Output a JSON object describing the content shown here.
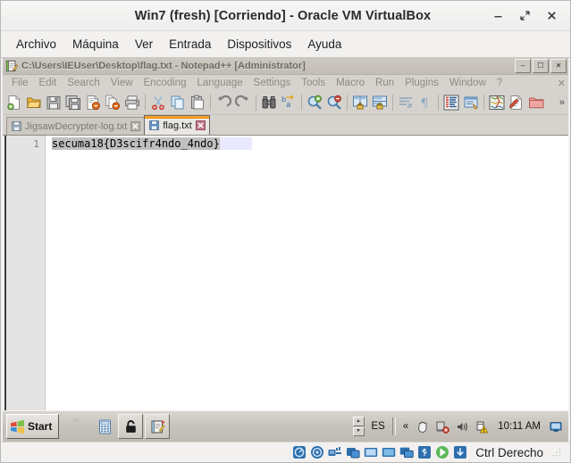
{
  "vbox": {
    "title": "Win7 (fresh) [Corriendo] - Oracle VM VirtualBox",
    "menu": [
      "Archivo",
      "Máquina",
      "Ver",
      "Entrada",
      "Dispositivos",
      "Ayuda"
    ],
    "window_buttons": [
      {
        "name": "minimize-button",
        "glyph": "minimize-icon"
      },
      {
        "name": "maximize-button",
        "glyph": "maximize-icon"
      },
      {
        "name": "close-button",
        "glyph": "close-icon"
      }
    ],
    "statusbar": {
      "icons": [
        "hard-disk-icon",
        "optical-disk-icon",
        "network-icon",
        "shared-folder-icon",
        "display-icon",
        "video-capture-icon",
        "remote-desktop-icon",
        "usb-icon",
        "mouse-integration-icon",
        "keyboard-icon"
      ],
      "host_key": "Ctrl Derecho"
    }
  },
  "notepadpp": {
    "title": "C:\\Users\\IEUser\\Desktop\\flag.txt - Notepad++ [Administrator]",
    "app_icon": "notepad-pencil-icon",
    "window_buttons": [
      {
        "name": "npp-minimize-button",
        "label": "–"
      },
      {
        "name": "npp-restore-button",
        "label": "☐"
      },
      {
        "name": "npp-close-button",
        "label": "✕"
      }
    ],
    "menu": [
      "File",
      "Edit",
      "Search",
      "View",
      "Encoding",
      "Language",
      "Settings",
      "Tools",
      "Macro",
      "Run",
      "Plugins",
      "Window",
      "?"
    ],
    "menu_close_doc": "✕",
    "toolbar": [
      {
        "name": "new-file-button",
        "icon": "new-document-icon"
      },
      {
        "name": "open-file-button",
        "icon": "open-folder-icon"
      },
      {
        "name": "save-button",
        "icon": "floppy-save-icon"
      },
      {
        "name": "save-all-button",
        "icon": "save-all-icon"
      },
      {
        "name": "close-file-button",
        "icon": "close-document-icon"
      },
      {
        "name": "close-all-button",
        "icon": "close-all-documents-icon"
      },
      {
        "name": "print-button",
        "icon": "printer-icon"
      },
      {
        "name": "separator-1",
        "icon": "separator"
      },
      {
        "name": "cut-button",
        "icon": "scissors-icon"
      },
      {
        "name": "copy-button",
        "icon": "copy-icon"
      },
      {
        "name": "paste-button",
        "icon": "paste-icon"
      },
      {
        "name": "separator-2",
        "icon": "separator"
      },
      {
        "name": "undo-button",
        "icon": "undo-arrow-icon"
      },
      {
        "name": "redo-button",
        "icon": "redo-arrow-icon"
      },
      {
        "name": "separator-3",
        "icon": "separator"
      },
      {
        "name": "find-button",
        "icon": "binoculars-icon"
      },
      {
        "name": "replace-button",
        "icon": "replace-icon"
      },
      {
        "name": "separator-4",
        "icon": "separator"
      },
      {
        "name": "zoom-in-button",
        "icon": "magnifier-plus-icon"
      },
      {
        "name": "zoom-out-button",
        "icon": "magnifier-minus-icon"
      },
      {
        "name": "separator-5",
        "icon": "separator"
      },
      {
        "name": "sync-vertical-scroll-button",
        "icon": "sync-scroll-vertical-icon"
      },
      {
        "name": "sync-horizontal-scroll-button",
        "icon": "sync-scroll-horizontal-icon"
      },
      {
        "name": "separator-6",
        "icon": "separator"
      },
      {
        "name": "word-wrap-button",
        "icon": "word-wrap-icon"
      },
      {
        "name": "show-all-chars-button",
        "icon": "pilcrow-icon"
      },
      {
        "name": "separator-7",
        "icon": "separator"
      },
      {
        "name": "indent-guideline-button",
        "icon": "indent-guide-icon"
      },
      {
        "name": "user-defined-dialog-button",
        "icon": "udl-dialog-icon"
      },
      {
        "name": "separator-8",
        "icon": "separator"
      },
      {
        "name": "document-map-button",
        "icon": "document-map-icon"
      },
      {
        "name": "function-list-button",
        "icon": "function-list-icon"
      },
      {
        "name": "folder-as-workspace-button",
        "icon": "folder-workspace-icon"
      }
    ],
    "toolbar_overflow": "»",
    "tabs": [
      {
        "label": "JigsawDecrypter-log.txt",
        "active": false,
        "icon": "save-floppy-blue-icon",
        "close": "close-tab-icon"
      },
      {
        "label": "flag.txt",
        "active": true,
        "icon": "save-floppy-blue-icon",
        "close": "close-tab-icon"
      }
    ],
    "editor": {
      "line_numbers": [
        "1"
      ],
      "lines": [
        "secuma18{D3scifr4ndo_4ndo}"
      ]
    }
  },
  "taskbar": {
    "start_label": "Start",
    "quick_launch": [
      {
        "name": "quote-icon",
        "framed": false
      },
      {
        "name": "calculator-icon",
        "framed": false
      },
      {
        "name": "padlock-icon",
        "framed": true
      },
      {
        "name": "notepad-pencil-icon",
        "framed": true
      }
    ],
    "tray": {
      "spinner_up": "▲",
      "spinner_down": "▼",
      "language": "ES",
      "show_hidden_icons": "«",
      "icons": [
        "hand-security-icon",
        "network-error-icon",
        "volume-icon",
        "action-center-warning-icon"
      ],
      "clock": "10:11 AM",
      "show_desktop": "show-desktop-icon"
    }
  },
  "colors": {
    "vbox_chrome": "#f2f1f0",
    "npp_chrome": "#d6d3ce",
    "editor_bg": "#ffffff",
    "gutter_bg": "#e4e4e4",
    "active_tab_accent": "#f08a00",
    "selection": "#c0c0c0",
    "taskbar": "#c7c3bc"
  }
}
